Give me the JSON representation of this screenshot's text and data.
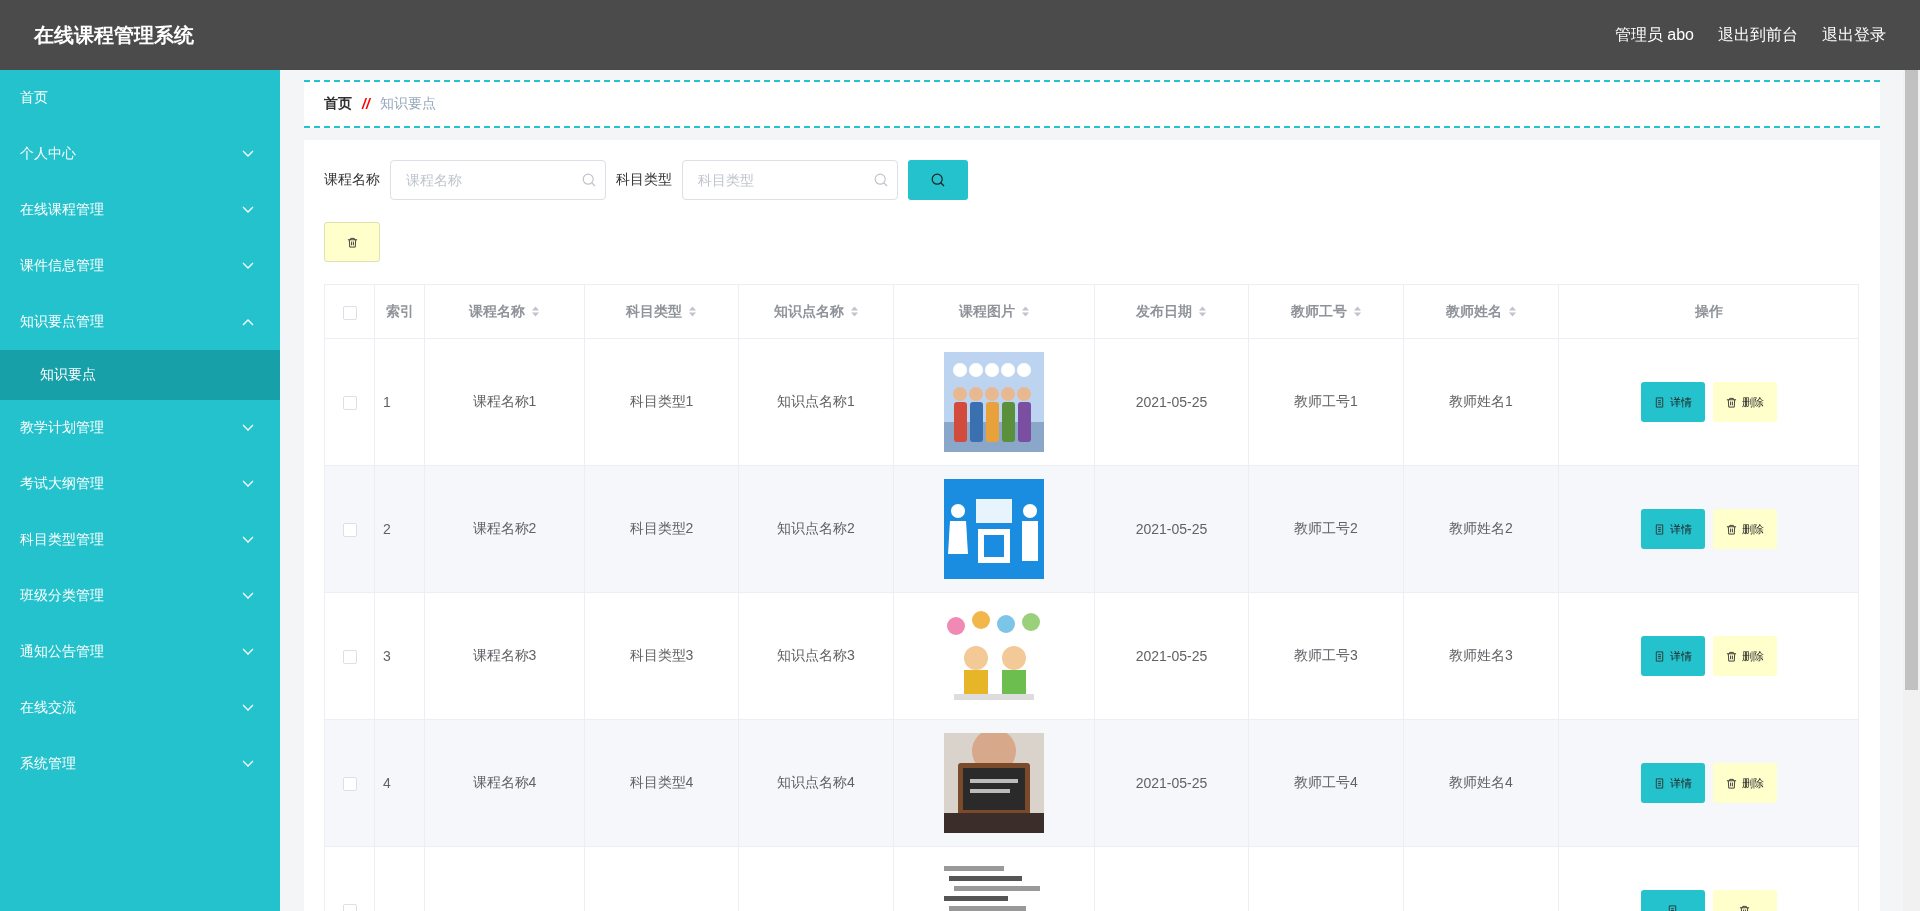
{
  "header": {
    "title": "在线课程管理系统",
    "links": [
      "管理员 abo",
      "退出到前台",
      "退出登录"
    ]
  },
  "sidebar": {
    "items": [
      {
        "label": "首页",
        "kind": "link"
      },
      {
        "label": "个人中心",
        "kind": "menu",
        "expanded": false
      },
      {
        "label": "在线课程管理",
        "kind": "menu",
        "expanded": false
      },
      {
        "label": "课件信息管理",
        "kind": "menu",
        "expanded": false
      },
      {
        "label": "知识要点管理",
        "kind": "menu",
        "expanded": true,
        "children": [
          {
            "label": "知识要点",
            "selected": true
          }
        ]
      },
      {
        "label": "教学计划管理",
        "kind": "menu",
        "expanded": false
      },
      {
        "label": "考试大纲管理",
        "kind": "menu",
        "expanded": false
      },
      {
        "label": "科目类型管理",
        "kind": "menu",
        "expanded": false
      },
      {
        "label": "班级分类管理",
        "kind": "menu",
        "expanded": false
      },
      {
        "label": "通知公告管理",
        "kind": "menu",
        "expanded": false
      },
      {
        "label": "在线交流",
        "kind": "menu",
        "expanded": false
      },
      {
        "label": "系统管理",
        "kind": "menu",
        "expanded": false
      }
    ]
  },
  "breadcrumb": {
    "home": "首页",
    "separator": "//",
    "current": "知识要点"
  },
  "search": {
    "fields": [
      {
        "label": "课程名称",
        "placeholder": "课程名称"
      },
      {
        "label": "科目类型",
        "placeholder": "科目类型"
      }
    ]
  },
  "table": {
    "header_checked": false,
    "columns": [
      {
        "label": "索引",
        "sortable": false
      },
      {
        "label": "课程名称",
        "sortable": true
      },
      {
        "label": "科目类型",
        "sortable": true
      },
      {
        "label": "知识点名称",
        "sortable": true
      },
      {
        "label": "课程图片",
        "sortable": true
      },
      {
        "label": "发布日期",
        "sortable": true
      },
      {
        "label": "教师工号",
        "sortable": true
      },
      {
        "label": "教师姓名",
        "sortable": true
      },
      {
        "label": "操作",
        "sortable": false
      }
    ],
    "rows": [
      {
        "checked": false,
        "cells": [
          "1",
          "课程名称1",
          "科目类型1",
          "知识点名称1",
          null,
          "2021-05-25",
          "教师工号1",
          "教师姓名1"
        ],
        "actions": [
          {
            "label": "详情",
            "kind": "detail"
          },
          {
            "label": "删除",
            "kind": "delete"
          }
        ]
      },
      {
        "checked": false,
        "cells": [
          "2",
          "课程名称2",
          "科目类型2",
          "知识点名称2",
          null,
          "2021-05-25",
          "教师工号2",
          "教师姓名2"
        ],
        "actions": [
          {
            "label": "详情",
            "kind": "detail"
          },
          {
            "label": "删除",
            "kind": "delete"
          }
        ]
      },
      {
        "checked": false,
        "cells": [
          "3",
          "课程名称3",
          "科目类型3",
          "知识点名称3",
          null,
          "2021-05-25",
          "教师工号3",
          "教师姓名3"
        ],
        "actions": [
          {
            "label": "详情",
            "kind": "detail"
          },
          {
            "label": "删除",
            "kind": "delete"
          }
        ]
      },
      {
        "checked": false,
        "cells": [
          "4",
          "课程名称4",
          "科目类型4",
          "知识点名称4",
          null,
          "2021-05-25",
          "教师工号4",
          "教师姓名4"
        ],
        "actions": [
          {
            "label": "详情",
            "kind": "detail"
          },
          {
            "label": "删除",
            "kind": "delete"
          }
        ]
      },
      {
        "checked": false,
        "actions": [
          {
            "kind": "detail"
          },
          {
            "kind": "delete"
          }
        ]
      }
    ]
  }
}
